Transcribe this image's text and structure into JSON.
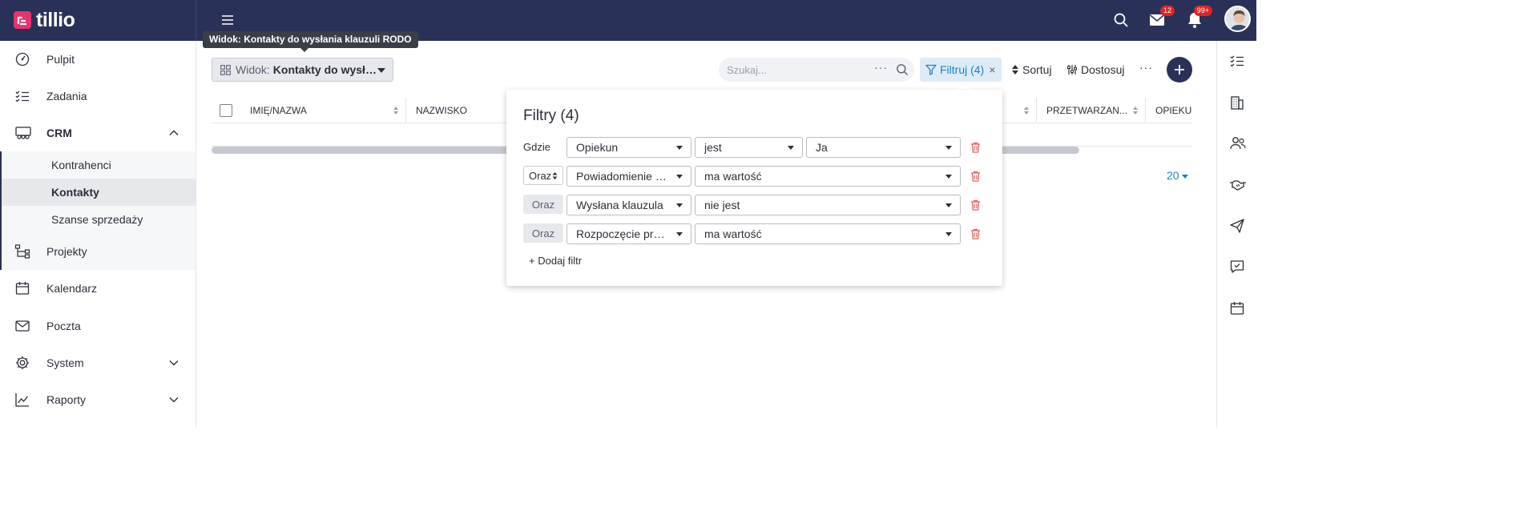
{
  "app": {
    "name": "tillio"
  },
  "topbar": {
    "mail_badge": "12",
    "notifications_badge": "99+"
  },
  "tooltip": {
    "text": "Widok: Kontakty do wysłania klauzuli RODO"
  },
  "sidebar": {
    "items": [
      {
        "label": "Pulpit"
      },
      {
        "label": "Zadania"
      },
      {
        "label": "CRM"
      },
      {
        "label": "Projekty"
      },
      {
        "label": "Kalendarz"
      },
      {
        "label": "Poczta"
      },
      {
        "label": "System"
      },
      {
        "label": "Raporty"
      }
    ],
    "crm_sub": [
      {
        "label": "Kontrahenci"
      },
      {
        "label": "Kontakty"
      },
      {
        "label": "Szanse sprzedaży"
      }
    ]
  },
  "toolbar": {
    "view_prefix": "Widok:",
    "view_value": "Kontakty do wysłania klauzuli RODO",
    "search_placeholder": "Szukaj...",
    "filter_label": "Filtruj (4)",
    "sort_label": "Sortuj",
    "customize_label": "Dostosuj"
  },
  "table": {
    "columns": [
      "IMIĘ/NAZWA",
      "NAZWISKO",
      "PRZETWARZAN...",
      "OPIEKUN"
    ],
    "page_size": "20"
  },
  "filter_panel": {
    "title": "Filtry (4)",
    "add_label": "+ Dodaj filtr",
    "rows": [
      {
        "connector": "Gdzie",
        "field": "Opiekun",
        "operator": "jest",
        "value": "Ja"
      },
      {
        "connector": "Oraz",
        "field": "Powiadomienie o ...",
        "operator": "ma wartość",
        "value": ""
      },
      {
        "connector": "Oraz",
        "field": "Wysłana klauzula",
        "operator": "nie jest",
        "value": ""
      },
      {
        "connector": "Oraz",
        "field": "Rozpoczęcie prze...",
        "operator": "ma wartość",
        "value": ""
      }
    ]
  },
  "colors": {
    "topbar": "#2a3158",
    "accent": "#1d7fc4",
    "brand": "#e8336d",
    "danger": "#e02424"
  }
}
